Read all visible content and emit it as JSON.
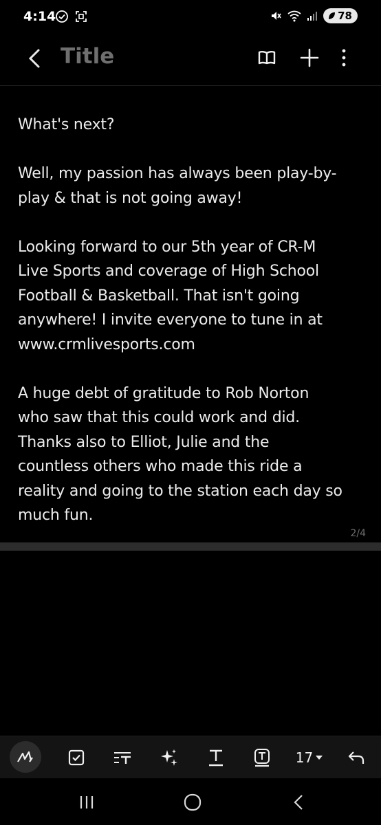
{
  "status_bar": {
    "time": "4:14",
    "battery": "78",
    "left_icons": [
      "check-circle-icon",
      "screenshot-icon"
    ],
    "right_icons": [
      "mute-icon",
      "wifi-icon",
      "signal-icon"
    ]
  },
  "app_bar": {
    "title": "Title",
    "actions": [
      "reading-mode-icon",
      "add-icon",
      "more-options-icon"
    ]
  },
  "note": {
    "paragraphs": [
      "What's next?",
      "Well,  my passion has always been play-by-\nplay & that is not going away!",
      "Looking forward to our 5th year of CR-M\nLive Sports and coverage of High School\nFootball & Basketball. That isn't going\nanywhere! I invite everyone to tune in at\nwww.crmlivesports.com",
      "A huge debt of gratitude to Rob Norton\nwho saw that this could work and did.\nThanks also to Elliot, Julie and the\ncountless others who made this ride a\nreality and going to the station each day so\nmuch fun."
    ],
    "page_indicator": "2/4"
  },
  "toolbar": {
    "tools": [
      "pen-icon",
      "checkbox-icon",
      "text-style-icon",
      "ai-sparkle-icon",
      "text-color-icon",
      "text-box-icon"
    ],
    "font_size": "17",
    "undo": "undo-icon"
  },
  "nav_bar": [
    "recent-apps-icon",
    "home-icon",
    "back-icon"
  ],
  "colors": {
    "background": "#000000",
    "text": "#ececec",
    "title": "#6f6f6f",
    "toolbar": "#141414"
  }
}
